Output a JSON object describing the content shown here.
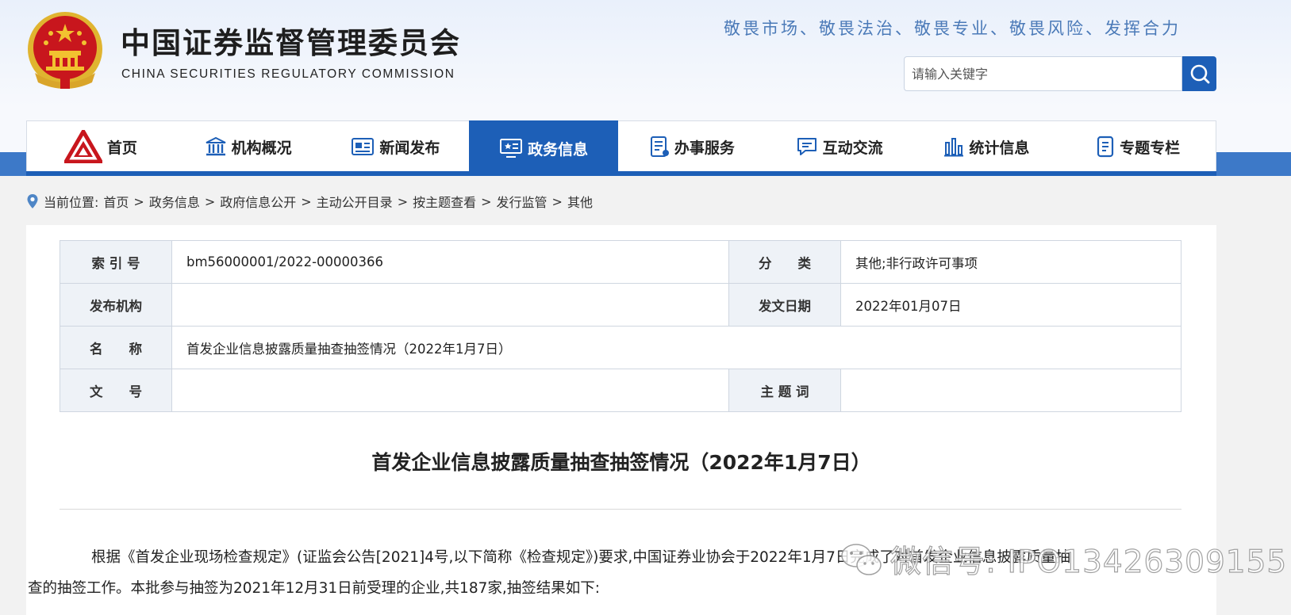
{
  "header": {
    "title_cn": "中国证券监督管理委员会",
    "title_en": "CHINA SECURITIES REGULATORY COMMISSION",
    "slogan": "敬畏市场、敬畏法治、敬畏专业、敬畏风险、发挥合力",
    "search": {
      "placeholder": "请输入关键字",
      "button_icon": "search-icon"
    }
  },
  "nav": [
    {
      "label": "首页",
      "icon": "csrc-logo-icon",
      "active": false
    },
    {
      "label": "机构概况",
      "icon": "building-icon",
      "active": false
    },
    {
      "label": "新闻发布",
      "icon": "newspaper-icon",
      "active": false
    },
    {
      "label": "政务信息",
      "icon": "monitor-icon",
      "active": true
    },
    {
      "label": "办事服务",
      "icon": "document-list-icon",
      "active": false
    },
    {
      "label": "互动交流",
      "icon": "chat-icon",
      "active": false
    },
    {
      "label": "统计信息",
      "icon": "bar-chart-icon",
      "active": false
    },
    {
      "label": "专题专栏",
      "icon": "column-doc-icon",
      "active": false
    }
  ],
  "breadcrumb": {
    "prefix": "当前位置:",
    "items": [
      "首页",
      "政务信息",
      "政府信息公开",
      "主动公开目录",
      "按主题查看",
      "发行监管",
      "其他"
    ]
  },
  "meta": {
    "index_label": "索 引 号",
    "index_value": "bm56000001/2022-00000366",
    "category_label": "分　　类",
    "category_value": "其他;非行政许可事项",
    "publisher_label": "发布机构",
    "publisher_value": "",
    "date_label": "发文日期",
    "date_value": "2022年01月07日",
    "name_label": "名　　称",
    "name_value": "首发企业信息披露质量抽查抽签情况（2022年1月7日）",
    "docno_label": "文　　号",
    "docno_value": "",
    "keywords_label": "主 题 词",
    "keywords_value": ""
  },
  "article": {
    "title": "首发企业信息披露质量抽查抽签情况（2022年1月7日）",
    "para_line1": "根据《首发企业现场检查规定》(证监会公告[2021]4号,以下简称《检查规定》)要求,中国证券业协会于2022年1月7日完成了对首发企业信息披露质量抽",
    "para_line2": "查的抽签工作。本批参与抽签为2021年12月31日前受理的企业,共187家,抽签结果如下:"
  },
  "watermark": {
    "text": "微信号: IPO13426309155"
  },
  "colors": {
    "brand_blue": "#1d5fb7",
    "band_blue": "#3d79c8",
    "slogan": "#4b7ab8",
    "emblem_red": "#c8161d",
    "emblem_gold": "#f2c230"
  }
}
